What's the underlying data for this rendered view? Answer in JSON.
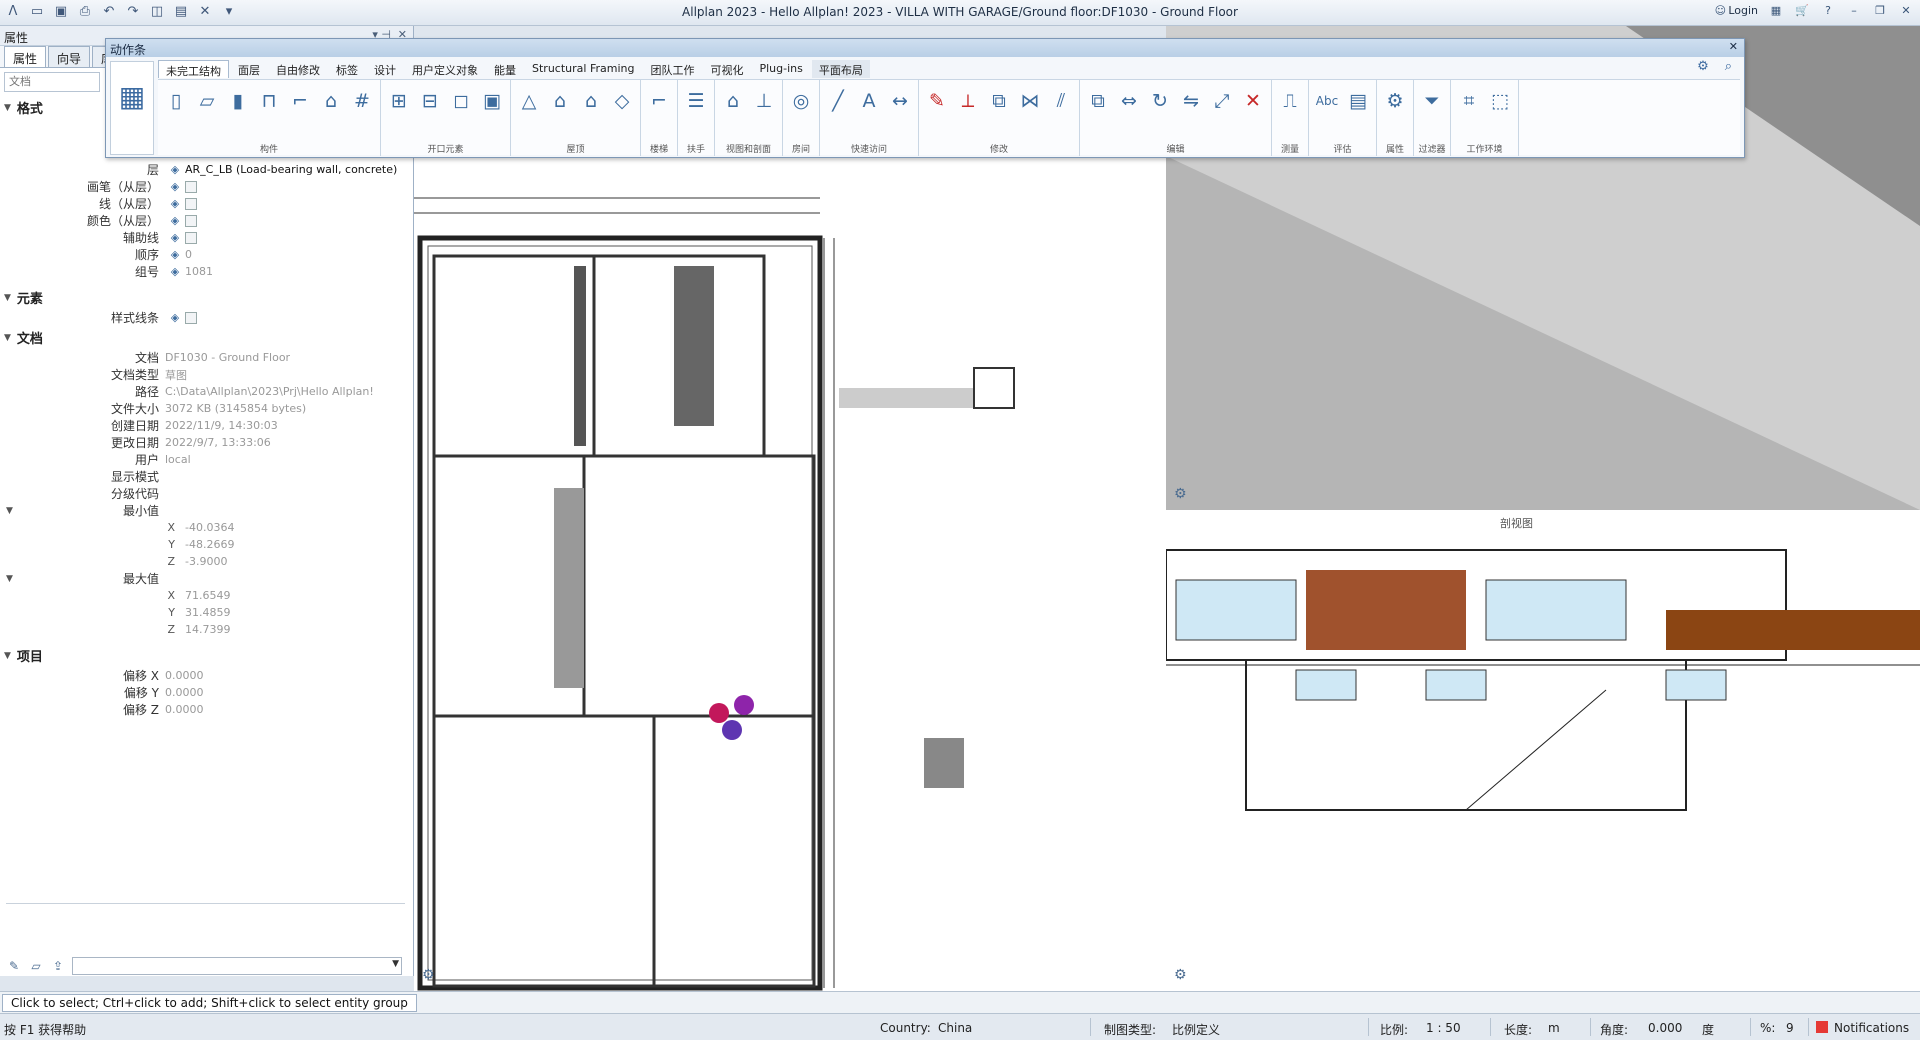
{
  "window": {
    "title": "Allplan 2023 - Hello Allplan! 2023 - VILLA WITH GARAGE/Ground floor:DF1030 - Ground Floor",
    "login_label": "Login",
    "qat_icons": [
      "allplan-logo-icon",
      "open-icon",
      "save-icon",
      "print-icon",
      "undo-icon",
      "redo-icon",
      "view-icon",
      "layout-icon",
      "tools-icon",
      "customize-icon"
    ],
    "right_icons": [
      "layers-icon",
      "cart-icon",
      "help-icon",
      "minimize-icon",
      "restore-icon",
      "close-icon"
    ]
  },
  "palette": {
    "title": "属性",
    "tabs": [
      "属性",
      "向导",
      "库"
    ],
    "search_placeholder": "文档",
    "sections": {
      "format": "格式",
      "element": "元素",
      "document": "文档",
      "project": "项目"
    },
    "format_rows": [
      {
        "label": "层",
        "value": "AR_C_LB (Load-bearing wall, concrete)"
      },
      {
        "label": "画笔（从层）",
        "value": ""
      },
      {
        "label": "线（从层）",
        "value": ""
      },
      {
        "label": "颜色（从层）",
        "value": ""
      },
      {
        "label": "辅助线",
        "value": ""
      },
      {
        "label": "顺序",
        "value": "0"
      },
      {
        "label": "组号",
        "value": "1081"
      }
    ],
    "element_rows": [
      {
        "label": "样式线条",
        "value": ""
      }
    ],
    "document_rows": [
      {
        "label": "文档",
        "value": "DF1030 - Ground Floor"
      },
      {
        "label": "文档类型",
        "value": "草图"
      },
      {
        "label": "路径",
        "value": "C:\\Data\\Allplan\\2023\\Prj\\Hello Allplan!"
      },
      {
        "label": "文件大小",
        "value": "3072 KB (3145854 bytes)"
      },
      {
        "label": "创建日期",
        "value": "2022/11/9, 14:30:03"
      },
      {
        "label": "更改日期",
        "value": "2022/9/7, 13:33:06"
      },
      {
        "label": "用户",
        "value": "local"
      },
      {
        "label": "显示模式",
        "value": ""
      },
      {
        "label": "分级代码",
        "value": ""
      }
    ],
    "min_label": "最小值",
    "min_values": [
      {
        "axis": "X",
        "value": "-40.0364"
      },
      {
        "axis": "Y",
        "value": "-48.2669"
      },
      {
        "axis": "Z",
        "value": "-3.9000"
      }
    ],
    "max_label": "最大值",
    "max_values": [
      {
        "axis": "X",
        "value": "71.6549"
      },
      {
        "axis": "Y",
        "value": "31.4859"
      },
      {
        "axis": "Z",
        "value": "14.7399"
      }
    ],
    "project_rows": [
      {
        "label": "偏移 X",
        "value": "0.0000"
      },
      {
        "label": "偏移 Y",
        "value": "0.0000"
      },
      {
        "label": "偏移 Z",
        "value": "0.0000"
      }
    ]
  },
  "actionbar": {
    "title": "动作条",
    "tabs": [
      "未完工结构",
      "面层",
      "自由修改",
      "标签",
      "设计",
      "用户定义对象",
      "能量",
      "Structural Framing",
      "团队工作",
      "可视化",
      "Plug-ins",
      "平面布局"
    ],
    "groups": [
      {
        "label": "构件",
        "icons": [
          "wall-icon",
          "slab-icon",
          "column-icon",
          "beam-icon",
          "stair-icon",
          "roof-icon",
          "grid-icon"
        ]
      },
      {
        "label": "开口元素",
        "icons": [
          "window-icon",
          "door-icon",
          "opening-icon",
          "recess-icon"
        ]
      },
      {
        "label": "屋顶",
        "icons": [
          "roof-plane-icon",
          "roof-cover-icon",
          "dormer-icon",
          "skylight-icon"
        ]
      },
      {
        "label": "楼梯",
        "icons": [
          "stair-tool-icon"
        ]
      },
      {
        "label": "扶手",
        "icons": [
          "railing-icon"
        ]
      },
      {
        "label": "视图和剖面",
        "icons": [
          "elevation-icon",
          "section-icon"
        ]
      },
      {
        "label": "房间",
        "icons": [
          "room-icon"
        ]
      },
      {
        "label": "快速访问",
        "icons": [
          "line-icon",
          "text-icon",
          "dimension-icon"
        ]
      },
      {
        "label": "修改",
        "icons": [
          "modify-icon",
          "trim-icon",
          "offset-icon",
          "join-icon",
          "split-icon"
        ]
      },
      {
        "label": "编辑",
        "icons": [
          "copy-icon",
          "stretch-icon",
          "rotate-icon",
          "mirror-icon",
          "scale-icon",
          "delete-icon"
        ]
      },
      {
        "label": "测量",
        "icons": [
          "measure-icon"
        ]
      },
      {
        "label": "评估",
        "icons": [
          "text-label-icon",
          "report-icon"
        ]
      },
      {
        "label": "属性",
        "icons": [
          "properties-icon"
        ]
      },
      {
        "label": "过滤器",
        "icons": [
          "filter-icon"
        ]
      },
      {
        "label": "工作环境",
        "icons": [
          "workspace-icon",
          "select-icon"
        ]
      }
    ]
  },
  "viewports": {
    "section_label": "剖视图"
  },
  "statusbar": {
    "hint": "Click to select; Ctrl+click to add; Shift+click to select entity group",
    "help": "按 F1 获得帮助",
    "country_label": "Country:",
    "country_value": "China",
    "drawing_type_label": "制图类型:",
    "drawing_type_value": "比例定义",
    "scale_label": "比例:",
    "scale_value": "1 : 50",
    "length_label": "长度:",
    "length_value": "m",
    "angle_label": "角度:",
    "angle_value": "0.000",
    "angle_unit": "度",
    "percent_label": "%:",
    "percent_value": "9",
    "notifications": "Notifications"
  },
  "colors": {
    "accent": "#3d6c9e",
    "delete_red": "#c62828"
  }
}
